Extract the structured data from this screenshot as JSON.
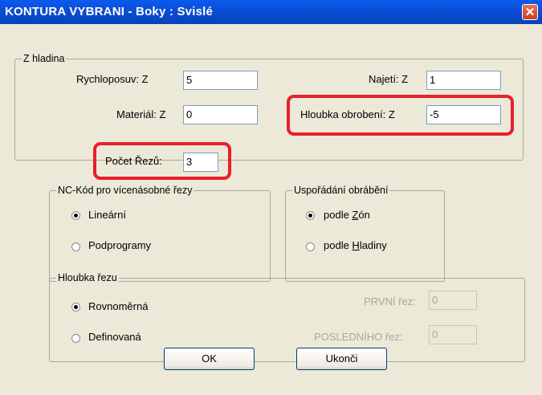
{
  "window": {
    "title": "KONTURA VYBRANI - Boky : Svislé",
    "close_glyph": "✕"
  },
  "z_level": {
    "legend": "Z hladina",
    "rapid_label": "Rychloposuv: Z",
    "rapid_value": "5",
    "approach_label": "Najetí: Z",
    "approach_value": "1",
    "material_label": "Materiál: Z",
    "material_value": "0",
    "depth_label": "Hloubka obrobení: Z",
    "depth_value": "-5"
  },
  "cuts": {
    "label": "Počet Řezů:",
    "value": "3"
  },
  "nc_code": {
    "legend": "NC-Kód pro vícenásobné řezy",
    "options": [
      {
        "label": "Lineární",
        "selected": true
      },
      {
        "label": "Podprogramy",
        "selected": false
      }
    ]
  },
  "machining_order": {
    "legend": "Uspořádání obrábění",
    "opt1_prefix": "podle ",
    "opt1_accel": "Z",
    "opt1_rest": "ón",
    "opt1_selected": true,
    "opt2_prefix": "podle ",
    "opt2_accel": "H",
    "opt2_rest": "ladiny",
    "opt2_selected": false
  },
  "cut_depth": {
    "legend": "Hloubka řezu",
    "options": [
      {
        "label": "Rovnoměrná",
        "selected": true
      },
      {
        "label": "Definovaná",
        "selected": false
      }
    ],
    "first_label": "PRVNÍ řez:",
    "first_value": "0",
    "last_label": "POSLEDNÍHO řez:",
    "last_value": "0"
  },
  "buttons": {
    "ok": "OK",
    "cancel": "Ukonči"
  },
  "colors": {
    "titlebar": "#0B4FD8",
    "highlight": "#E8202A",
    "dialog_bg": "#ECE9D8"
  }
}
